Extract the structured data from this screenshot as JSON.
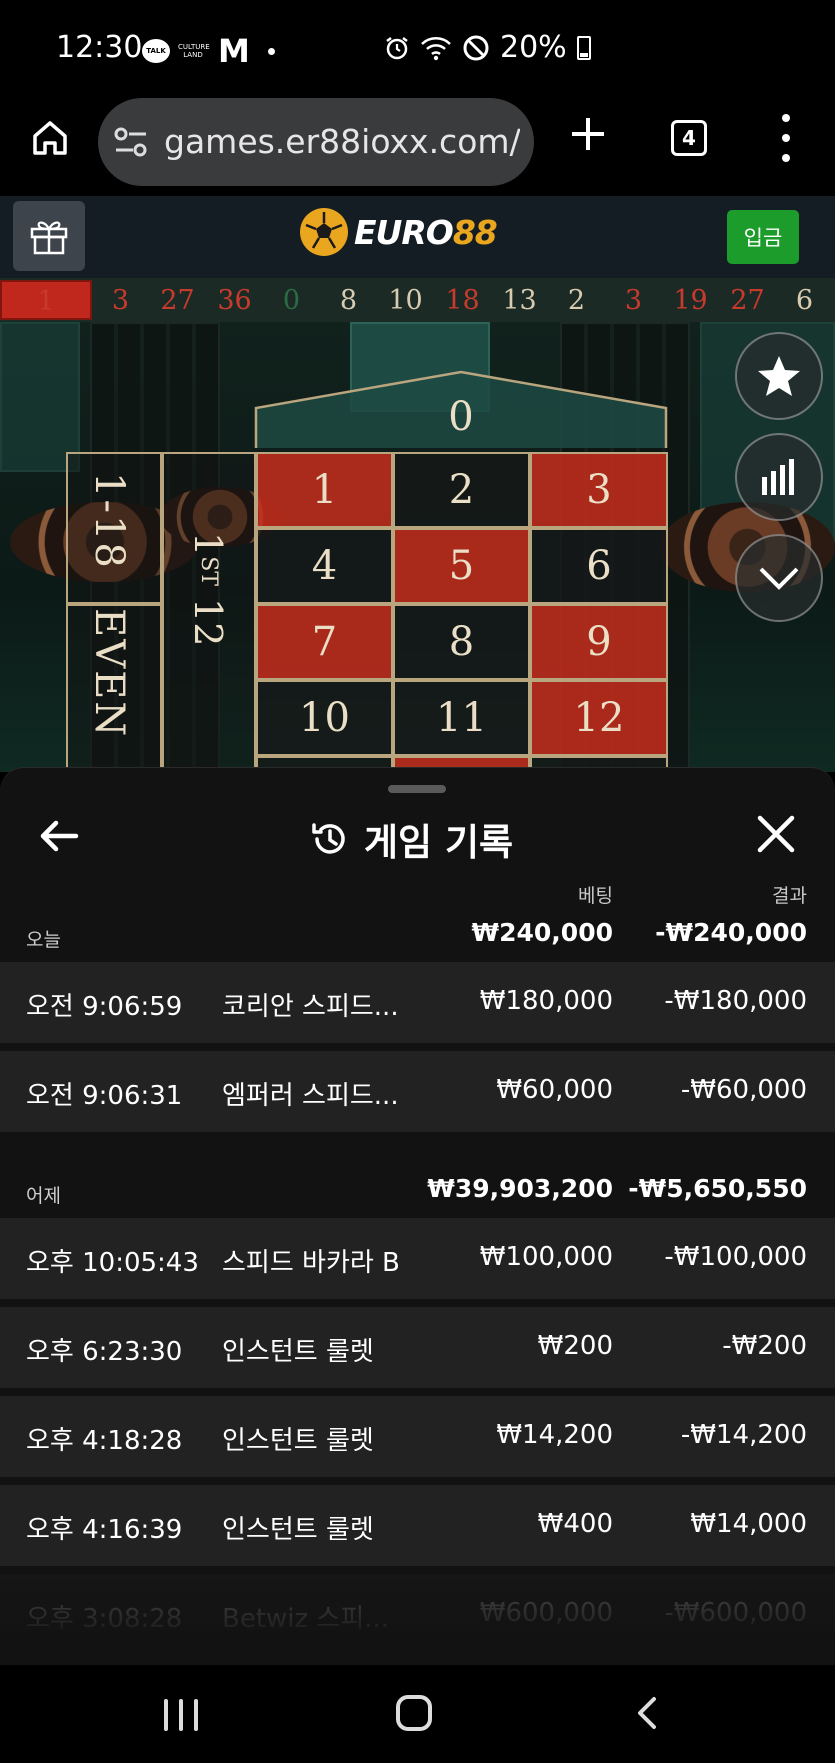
{
  "status_bar": {
    "time": "12:30",
    "talk_label": "TALK",
    "culture_label": "CULTURE LAND",
    "m_label": "M",
    "battery": "20%",
    "icons": [
      "alarm-icon",
      "wifi-icon",
      "do-not-disturb-icon",
      "battery-icon"
    ]
  },
  "browser": {
    "url": "games.er88ioxx.com/l",
    "tab_count": "4"
  },
  "site_header": {
    "logo_text_main": "EURO",
    "logo_text_accent": "88",
    "deposit_label": "입금",
    "colors": {
      "accent": "#e9a61e",
      "deposit": "#1c9d2b",
      "header_bg": "#151d24"
    }
  },
  "history": [
    {
      "n": "1",
      "color": "red"
    },
    {
      "n": "3",
      "color": "red"
    },
    {
      "n": "27",
      "color": "red"
    },
    {
      "n": "36",
      "color": "red"
    },
    {
      "n": "0",
      "color": "green"
    },
    {
      "n": "8",
      "color": "black"
    },
    {
      "n": "10",
      "color": "black"
    },
    {
      "n": "18",
      "color": "red"
    },
    {
      "n": "13",
      "color": "black"
    },
    {
      "n": "2",
      "color": "black"
    },
    {
      "n": "3",
      "color": "red"
    },
    {
      "n": "19",
      "color": "red"
    },
    {
      "n": "27",
      "color": "red"
    },
    {
      "n": "6",
      "color": "black"
    }
  ],
  "table": {
    "zero": "0",
    "dozen_main": "1",
    "dozen_sup": "ST",
    "dozen_num": "12",
    "low": "1-18",
    "even": "EVEN",
    "numbers": [
      {
        "n": "1",
        "color": "red"
      },
      {
        "n": "2",
        "color": "black"
      },
      {
        "n": "3",
        "color": "red"
      },
      {
        "n": "4",
        "color": "black"
      },
      {
        "n": "5",
        "color": "red"
      },
      {
        "n": "6",
        "color": "black"
      },
      {
        "n": "7",
        "color": "red"
      },
      {
        "n": "8",
        "color": "black"
      },
      {
        "n": "9",
        "color": "red"
      },
      {
        "n": "10",
        "color": "black"
      },
      {
        "n": "11",
        "color": "black"
      },
      {
        "n": "12",
        "color": "red"
      }
    ]
  },
  "sheet": {
    "title": "게임 기록",
    "col_bet": "베팅",
    "col_result": "결과",
    "groups": [
      {
        "label": "오늘",
        "total_bet": "₩240,000",
        "total_result": "-₩240,000",
        "rows": [
          {
            "time": "오전 9:06:59",
            "game": "코리안 스피드...",
            "bet": "₩180,000",
            "result": "-₩180,000"
          },
          {
            "time": "오전 9:06:31",
            "game": "엠퍼러 스피드...",
            "bet": "₩60,000",
            "result": "-₩60,000"
          }
        ]
      },
      {
        "label": "어제",
        "total_bet": "₩39,903,200",
        "total_result": "-₩5,650,550",
        "rows": [
          {
            "time": "오후 10:05:43",
            "game": "스피드 바카라 B",
            "bet": "₩100,000",
            "result": "-₩100,000"
          },
          {
            "time": "오후 6:23:30",
            "game": "인스턴트 룰렛",
            "bet": "₩200",
            "result": "-₩200"
          },
          {
            "time": "오후 4:18:28",
            "game": "인스턴트 룰렛",
            "bet": "₩14,200",
            "result": "-₩14,200"
          },
          {
            "time": "오후 4:16:39",
            "game": "인스턴트 룰렛",
            "bet": "₩400",
            "result": "₩14,000"
          },
          {
            "time": "오후 3:08:28",
            "game": "Betwiz 스피...",
            "bet": "₩600,000",
            "result": "-₩600,000"
          }
        ]
      }
    ]
  }
}
